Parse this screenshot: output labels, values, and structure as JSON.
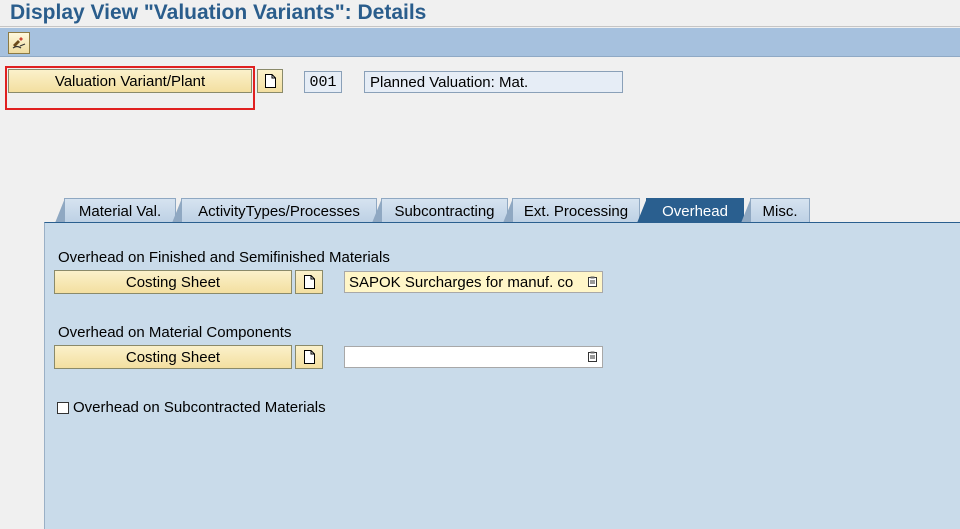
{
  "window": {
    "title": "Display View \"Valuation Variants\": Details"
  },
  "toolbar": {
    "edit_icon": "display-change-icon"
  },
  "header": {
    "valuation_button_label": "Valuation Variant/Plant",
    "variant_code": "001",
    "variant_description": "Planned Valuation: Mat."
  },
  "tabs": [
    {
      "label": "Material Val."
    },
    {
      "label": "ActivityTypes/Processes"
    },
    {
      "label": "Subcontracting"
    },
    {
      "label": "Ext. Processing"
    },
    {
      "label": "Overhead",
      "active": true
    },
    {
      "label": "Misc."
    }
  ],
  "overhead": {
    "finished_section_label": "Overhead on Finished and Semifinished Materials",
    "finished_costing_sheet_button": "Costing Sheet",
    "finished_costing_sheet_value": "SAPOK Surcharges for manuf. co",
    "components_section_label": "Overhead on Material Components",
    "components_costing_sheet_button": "Costing Sheet",
    "components_costing_sheet_value": "",
    "subcontracted_checkbox_label": "Overhead on Subcontracted Materials",
    "subcontracted_checked": false
  },
  "colors": {
    "title": "#2a5d8c",
    "toolbar": "#a6c1de",
    "button_yellow": "#f3dfa0",
    "active_tab": "#2a5f8f",
    "panel": "#c9dbea",
    "highlight_box": "#e02020"
  }
}
